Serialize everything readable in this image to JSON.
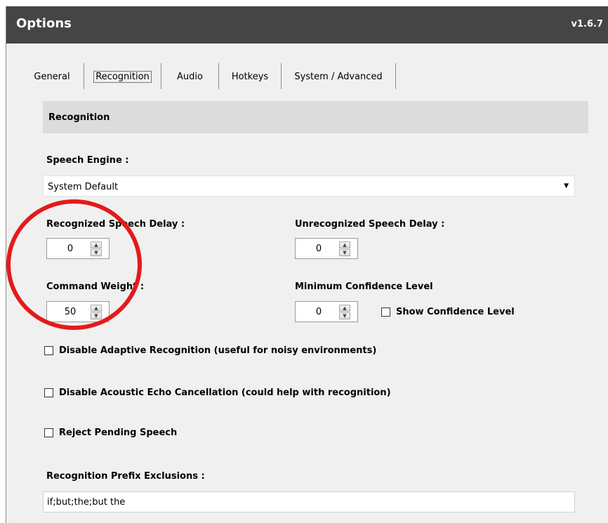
{
  "window": {
    "title": "Options",
    "version": "v1.6.7"
  },
  "tabs": [
    {
      "label": "General"
    },
    {
      "label": "Recognition",
      "active": true
    },
    {
      "label": "Audio"
    },
    {
      "label": "Hotkeys"
    },
    {
      "label": "System / Advanced"
    }
  ],
  "section": {
    "title": "Recognition"
  },
  "speech_engine": {
    "label": "Speech Engine :",
    "selected": "System Default"
  },
  "recognized_delay": {
    "label": "Recognized Speech Delay :",
    "value": "0"
  },
  "unrecognized_delay": {
    "label": "Unrecognized Speech Delay :",
    "value": "0"
  },
  "command_weight": {
    "label": "Command Weight :",
    "value": "50"
  },
  "min_confidence": {
    "label": "Minimum Confidence Level",
    "value": "0"
  },
  "show_confidence": {
    "label": "Show Confidence Level",
    "checked": false
  },
  "checkboxes": {
    "adaptive": {
      "label": "Disable Adaptive Recognition (useful for noisy environments)",
      "checked": false
    },
    "echo": {
      "label": "Disable Acoustic Echo Cancellation (could help with recognition)",
      "checked": false
    },
    "reject": {
      "label": "Reject Pending Speech",
      "checked": false
    }
  },
  "prefix_exclusions": {
    "label": "Recognition Prefix Exclusions :",
    "value": "if;but;the;but the"
  },
  "colors": {
    "titlebar": "#454545",
    "annotation": "#e31b1b",
    "panel": "#f0f0f0",
    "header": "#dcdcdc"
  }
}
